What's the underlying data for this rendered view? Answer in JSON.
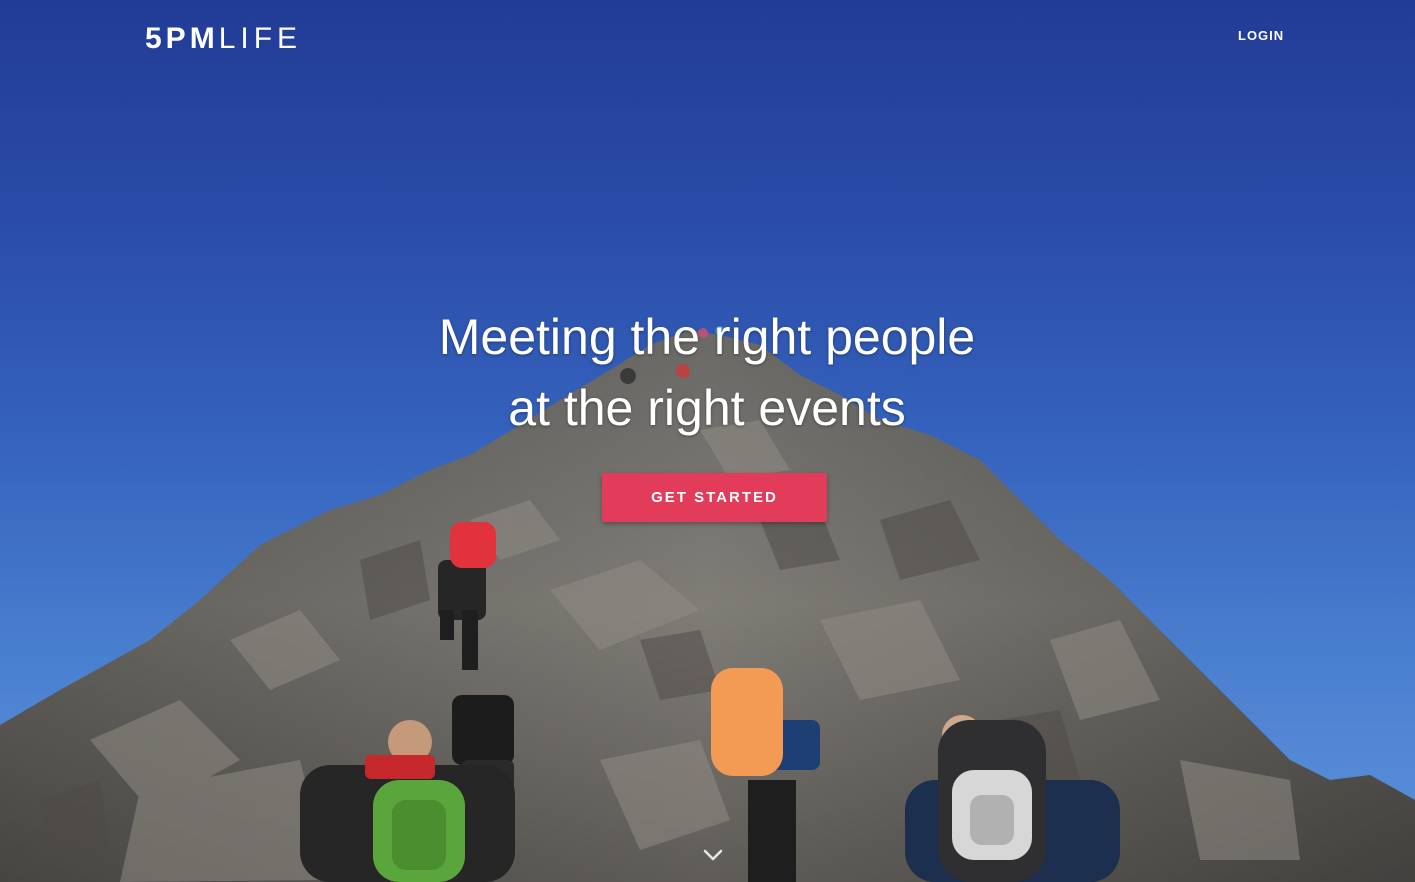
{
  "brand": {
    "logo_bold": "5PM",
    "logo_light": "LIFE"
  },
  "nav": {
    "login_label": "LOGIN"
  },
  "hero": {
    "headline_line1": "Meeting the right people",
    "headline_line2": "at the right events",
    "cta_label": "GET STARTED",
    "background_image": "mountain-hikers-photo"
  },
  "icons": {
    "scroll": "chevron-down-icon"
  },
  "colors": {
    "sky_top": "#213c97",
    "sky_bottom": "#5d93da",
    "cta": "#e23c5a",
    "text": "#ffffff"
  }
}
